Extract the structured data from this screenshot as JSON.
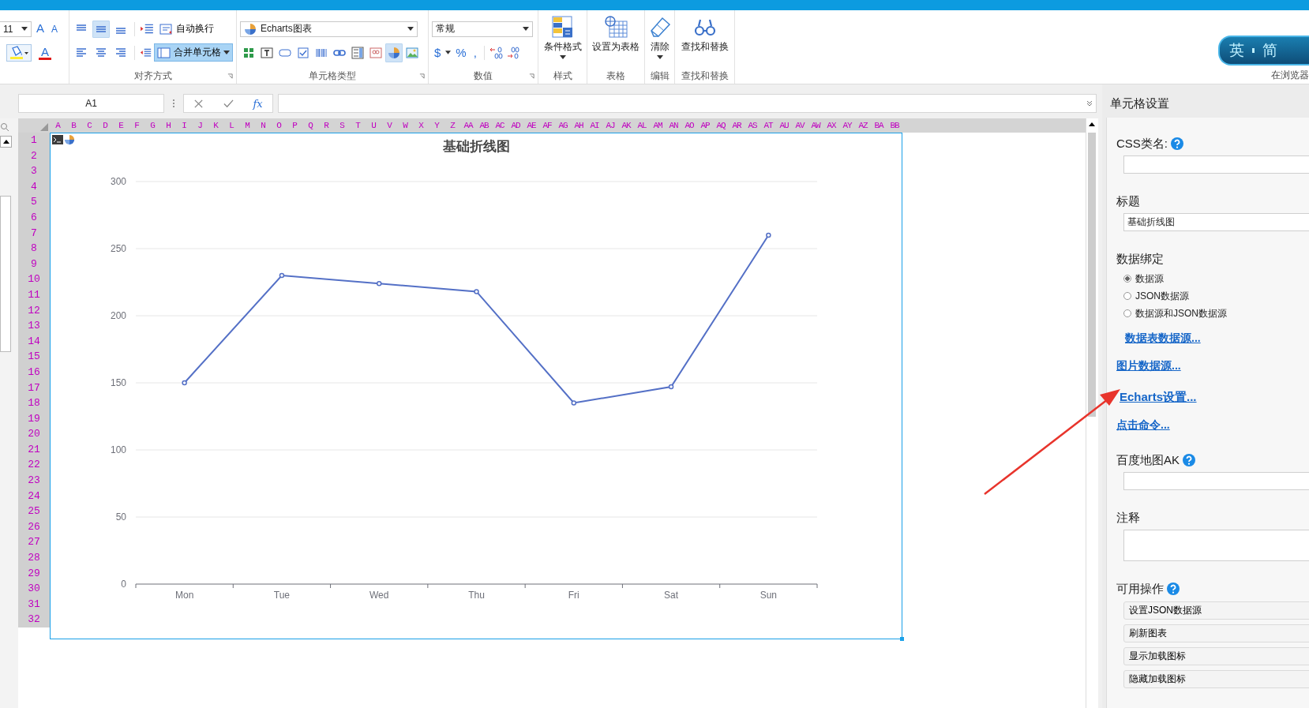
{
  "ribbon": {
    "font_group": {
      "size": "11",
      "grow_label": "A",
      "shrink_label": "A",
      "text_label": "A"
    },
    "align_group": {
      "label": "对齐方式",
      "wrap_button": "自动换行",
      "merge_button": {
        "label": "合并单元格",
        "selected": true
      },
      "valign_buttons": [
        {
          "selected": false
        },
        {
          "selected": true
        },
        {
          "selected": false
        }
      ]
    },
    "cell_type_group": {
      "label": "单元格类型",
      "dropdown": "Echarts图表",
      "buttons": [
        {
          "selected": false
        },
        {
          "selected": false
        },
        {
          "selected": false
        },
        {
          "selected": false
        },
        {
          "selected": false
        },
        {
          "selected": false
        },
        {
          "selected": false
        },
        {
          "selected": false
        },
        {
          "selected": true
        },
        {
          "selected": false
        }
      ]
    },
    "number_group": {
      "label": "数值",
      "dropdown": "常规",
      "currency": "$",
      "percent": "%",
      "comma": ","
    },
    "big_groups": [
      {
        "label": "样式",
        "button": "条件格式",
        "dropdown": true
      },
      {
        "label": "表格",
        "button": "设置为表格",
        "dropdown": false
      },
      {
        "label": "编辑",
        "button": "清除",
        "dropdown": true
      },
      {
        "label": "查找和替换",
        "button": "查找和替换",
        "dropdown": false
      }
    ],
    "ime_badge": {
      "chars": [
        "英",
        "简"
      ],
      "label": "在浏览器"
    }
  },
  "formula_bar": {
    "name_box": "A1",
    "fx": "fx"
  },
  "sheet": {
    "columns": [
      "A",
      "B",
      "C",
      "D",
      "E",
      "F",
      "G",
      "H",
      "I",
      "J",
      "K",
      "L",
      "M",
      "N",
      "O",
      "P",
      "Q",
      "R",
      "S",
      "T",
      "U",
      "V",
      "W",
      "X",
      "Y",
      "Z",
      "AA",
      "AB",
      "AC",
      "AD",
      "AE",
      "AF",
      "AG",
      "AH",
      "AI",
      "AJ",
      "AK",
      "AL",
      "AM",
      "AN",
      "AO",
      "AP",
      "AQ",
      "AR",
      "AS",
      "AT",
      "AU",
      "AV",
      "AW",
      "AX",
      "AY",
      "AZ",
      "BA",
      "BB"
    ],
    "rows": [
      "1",
      "2",
      "3",
      "4",
      "5",
      "6",
      "7",
      "8",
      "9",
      "10",
      "11",
      "12",
      "13",
      "14",
      "15",
      "16",
      "17",
      "18",
      "19",
      "20",
      "21",
      "22",
      "23",
      "24",
      "25",
      "26",
      "27",
      "28",
      "29",
      "30",
      "31",
      "32"
    ],
    "chart": {
      "chart_data": {
        "type": "line",
        "title": "基础折线图",
        "categories": [
          "Mon",
          "Tue",
          "Wed",
          "Thu",
          "Fri",
          "Sat",
          "Sun"
        ],
        "values": [
          150,
          230,
          224,
          218,
          135,
          147,
          260
        ],
        "ylim": [
          0,
          300
        ],
        "yticks": [
          0,
          50,
          100,
          150,
          200,
          250,
          300
        ],
        "grid": true,
        "marker": true
      }
    }
  },
  "settings_panel": {
    "title": "单元格设置",
    "css_class": {
      "label": "CSS类名:"
    },
    "caption": {
      "label": "标题",
      "value": "基础折线图"
    },
    "data_binding": {
      "label": "数据绑定",
      "options": [
        {
          "label": "数据源",
          "selected": true
        },
        {
          "label": "JSON数据源",
          "selected": false
        },
        {
          "label": "数据源和JSON数据源",
          "selected": false
        }
      ],
      "link": "数据表数据源..."
    },
    "links": [
      "图片数据源...",
      "Echarts设置...",
      "点击命令..."
    ],
    "baidu_ak": {
      "label": "百度地图AK"
    },
    "note": {
      "label": "注释"
    },
    "actions": {
      "label": "可用操作",
      "buttons": [
        "设置JSON数据源",
        "刷新图表",
        "显示加载图标",
        "隐藏加载图标"
      ]
    }
  }
}
